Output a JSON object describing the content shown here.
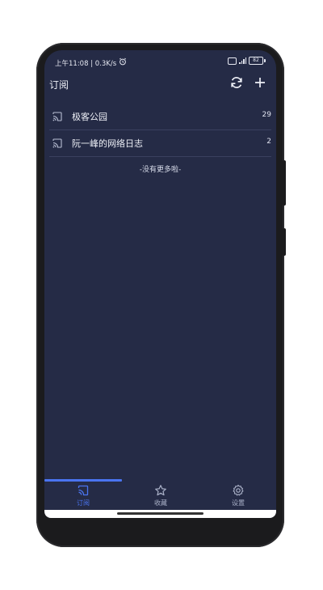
{
  "status_bar": {
    "time_speed": "上午11:08 | 0.3K/s",
    "battery": "82"
  },
  "toolbar": {
    "title": "订阅",
    "refresh_icon": "refresh-icon",
    "add_icon": "plus-icon"
  },
  "feeds": [
    {
      "name": "极客公园",
      "count": "29",
      "icon": "rss-cast-icon"
    },
    {
      "name": "阮一峰的网络日志",
      "count": "2",
      "icon": "rss-cast-icon"
    }
  ],
  "list_footer": "-没有更多啦-",
  "bottom_nav": {
    "tabs": [
      {
        "label": "订阅",
        "icon": "rss-cast-icon",
        "active": true
      },
      {
        "label": "收藏",
        "icon": "star-icon",
        "active": false
      },
      {
        "label": "设置",
        "icon": "gear-icon",
        "active": false
      }
    ]
  },
  "colors": {
    "background": "#252b46",
    "accent": "#4a74f0",
    "text": "#e7e9f2",
    "divider": "#3a415f"
  }
}
